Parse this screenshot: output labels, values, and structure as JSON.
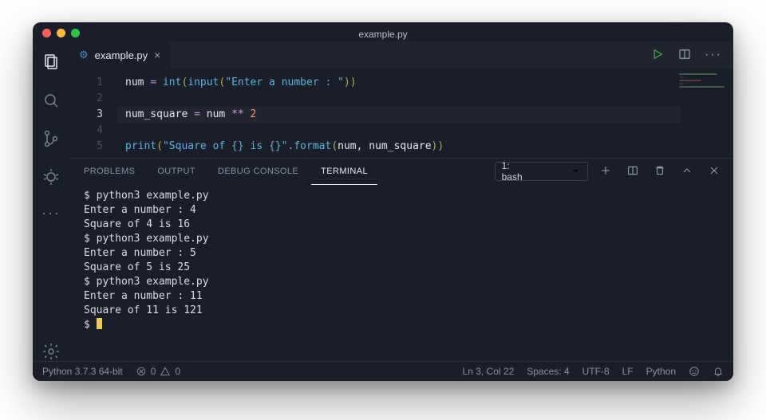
{
  "title": "example.py",
  "tab": {
    "icon": "⚙",
    "label": "example.py"
  },
  "editor": {
    "lines": [
      [
        {
          "t": "num ",
          "c": "tk-var"
        },
        {
          "t": "=",
          "c": "tk-op"
        },
        {
          "t": " ",
          "c": ""
        },
        {
          "t": "int",
          "c": "tk-builtin"
        },
        {
          "t": "(",
          "c": "tk-punc"
        },
        {
          "t": "input",
          "c": "tk-builtin"
        },
        {
          "t": "(",
          "c": "tk-punc"
        },
        {
          "t": "\"Enter a number : \"",
          "c": "tk-str"
        },
        {
          "t": ")",
          "c": "tk-punc"
        },
        {
          "t": ")",
          "c": "tk-punc"
        }
      ],
      [],
      [
        {
          "t": "num_square ",
          "c": "tk-var"
        },
        {
          "t": "=",
          "c": "tk-op"
        },
        {
          "t": " num ",
          "c": "tk-var"
        },
        {
          "t": "**",
          "c": "tk-op"
        },
        {
          "t": " ",
          "c": ""
        },
        {
          "t": "2",
          "c": "tk-num"
        }
      ],
      [],
      [
        {
          "t": "print",
          "c": "tk-fn"
        },
        {
          "t": "(",
          "c": "tk-punc"
        },
        {
          "t": "\"Square of {} is {}\"",
          "c": "tk-str"
        },
        {
          "t": ".",
          "c": "tk-dot"
        },
        {
          "t": "format",
          "c": "tk-fn"
        },
        {
          "t": "(",
          "c": "tk-punc"
        },
        {
          "t": "num",
          "c": "tk-var"
        },
        {
          "t": ",",
          "c": "tk-var"
        },
        {
          "t": " num_square",
          "c": "tk-var"
        },
        {
          "t": ")",
          "c": "tk-punc"
        },
        {
          "t": ")",
          "c": "tk-punc"
        }
      ]
    ],
    "current_line": 3
  },
  "panel": {
    "tabs": [
      "PROBLEMS",
      "OUTPUT",
      "DEBUG CONSOLE",
      "TERMINAL"
    ],
    "active_tab_index": 3,
    "shell_label": "1: bash"
  },
  "terminal_lines": [
    "$ python3 example.py",
    "Enter a number : 4",
    "Square of 4 is 16",
    "$ python3 example.py",
    "Enter a number : 5",
    "Square of 5 is 25",
    "$ python3 example.py",
    "Enter a number : 11",
    "Square of 11 is 121",
    "$ "
  ],
  "status": {
    "python": "Python 3.7.3 64-bit",
    "errors": "0",
    "warnings": "0",
    "lncol": "Ln 3, Col 22",
    "spaces": "Spaces: 4",
    "encoding": "UTF-8",
    "eol": "LF",
    "lang": "Python"
  },
  "icons": {
    "explorer": "explorer-icon",
    "search": "search-icon",
    "scm": "source-control-icon",
    "debug": "debug-icon",
    "more": "ellipsis-icon",
    "settings": "gear-icon",
    "run": "play-icon",
    "split": "split-editor-icon",
    "overflow": "ellipsis-icon",
    "plus": "plus-icon",
    "splitTerm": "split-terminal-icon",
    "trash": "trash-icon",
    "chevUp": "chevron-up-icon",
    "close": "close-icon",
    "chevDown": "chevron-down-icon",
    "smile": "feedback-icon",
    "bell": "bell-icon",
    "ban": "error-icon",
    "warn": "warning-icon"
  }
}
